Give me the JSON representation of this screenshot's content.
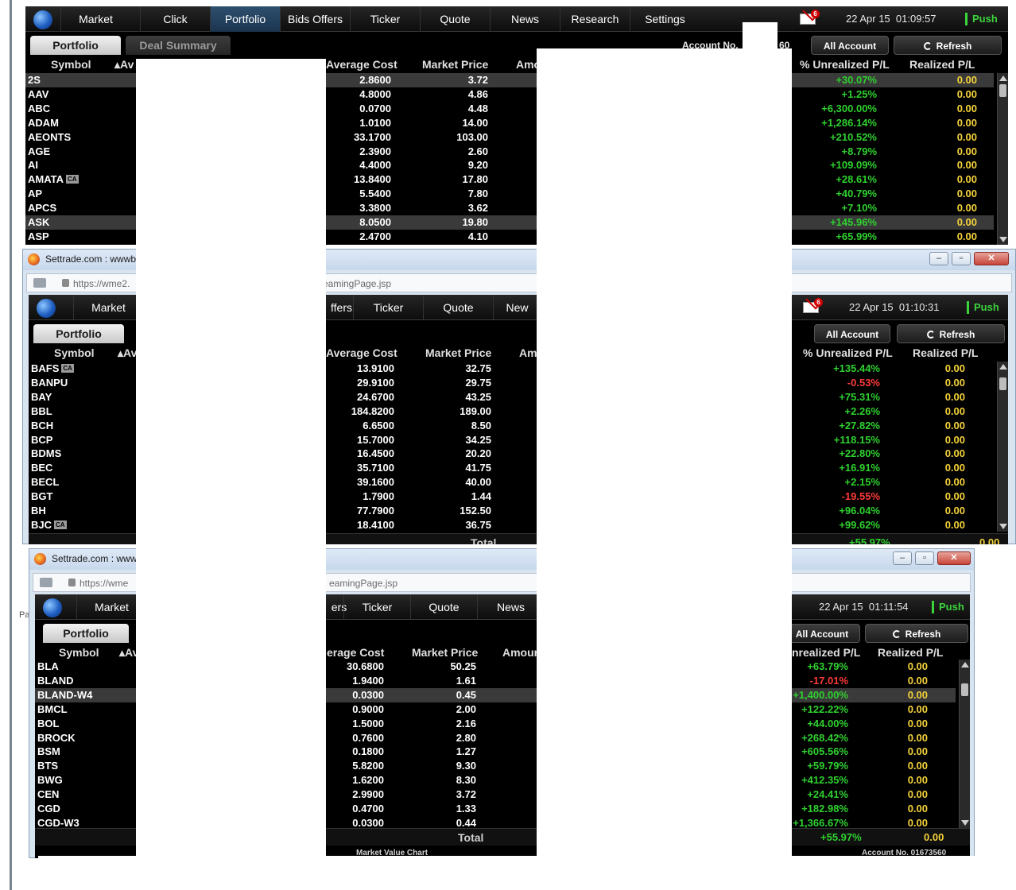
{
  "desktop": {
    "partial_label": "Pa"
  },
  "columns": {
    "symbol": "Symbol",
    "average_cost": "Average Cost",
    "market_price": "Market Price",
    "unrealized_pct": "% Unrealized P/L",
    "realized": "Realized P/L",
    "amount_partial": "Amo"
  },
  "panels": [
    {
      "title": "",
      "url": "",
      "nav": [
        "Market",
        "Click",
        "Portfolio",
        "Bids Offers",
        "Ticker",
        "Quote",
        "News",
        "Research",
        "Settings"
      ],
      "mail_count": "6",
      "date": "22 Apr 15",
      "time": "01:09:57",
      "push": "Push",
      "tabs": [
        "Portfolio",
        "Deal Summary"
      ],
      "account_label": "Account No.",
      "account_partial": "60",
      "all_account": "All Account",
      "refresh": "Refresh",
      "rows": [
        {
          "symbol": "2S",
          "avg": "2.8600",
          "price": "3.72",
          "pct": "+30.07%",
          "realized": "0.00",
          "sel": true
        },
        {
          "symbol": "AAV",
          "avg": "4.8000",
          "price": "4.86",
          "pct": "+1.25%",
          "realized": "0.00"
        },
        {
          "symbol": "ABC",
          "avg": "0.0700",
          "price": "4.48",
          "pct": "+6,300.00%",
          "realized": "0.00"
        },
        {
          "symbol": "ADAM",
          "avg": "1.0100",
          "price": "14.00",
          "pct": "+1,286.14%",
          "realized": "0.00"
        },
        {
          "symbol": "AEONTS",
          "avg": "33.1700",
          "price": "103.00",
          "pct": "+210.52%",
          "realized": "0.00"
        },
        {
          "symbol": "AGE",
          "avg": "2.3900",
          "price": "2.60",
          "pct": "+8.79%",
          "realized": "0.00"
        },
        {
          "symbol": "AI",
          "avg": "4.4000",
          "price": "9.20",
          "pct": "+109.09%",
          "realized": "0.00"
        },
        {
          "symbol": "AMATA",
          "ca": "CA",
          "avg": "13.8400",
          "price": "17.80",
          "pct": "+28.61%",
          "realized": "0.00"
        },
        {
          "symbol": "AP",
          "avg": "5.5400",
          "price": "7.80",
          "pct": "+40.79%",
          "realized": "0.00"
        },
        {
          "symbol": "APCS",
          "avg": "3.3800",
          "price": "3.62",
          "pct": "+7.10%",
          "realized": "0.00"
        },
        {
          "symbol": "ASK",
          "avg": "8.0500",
          "price": "19.80",
          "pct": "+145.96%",
          "realized": "0.00",
          "sel": true
        },
        {
          "symbol": "ASP",
          "avg": "2.4700",
          "price": "4.10",
          "pct": "+65.99%",
          "realized": "0.00"
        }
      ]
    },
    {
      "title": "Settrade.com : wwwb",
      "url": "https://wme2.",
      "url_tail": "eamingPage.jsp",
      "nav": [
        "Market",
        "ffers",
        "Ticker",
        "Quote",
        "New"
      ],
      "mail_count": "6",
      "date": "22 Apr 15",
      "time": "01:10:31",
      "push": "Push",
      "tabs": [
        "Portfolio"
      ],
      "all_account": "All Account",
      "refresh": "Refresh",
      "total_label": "Total",
      "total_pct": "+55.97%",
      "total_realized": "0.00",
      "rows": [
        {
          "symbol": "BAFS",
          "ca": "CA",
          "avg": "13.9100",
          "price": "32.75",
          "pct": "+135.44%",
          "realized": "0.00"
        },
        {
          "symbol": "BANPU",
          "avg": "29.9100",
          "price": "29.75",
          "pct": "-0.53%",
          "realized": "0.00"
        },
        {
          "symbol": "BAY",
          "avg": "24.6700",
          "price": "43.25",
          "pct": "+75.31%",
          "realized": "0.00"
        },
        {
          "symbol": "BBL",
          "avg": "184.8200",
          "price": "189.00",
          "pct": "+2.26%",
          "realized": "0.00"
        },
        {
          "symbol": "BCH",
          "avg": "6.6500",
          "price": "8.50",
          "pct": "+27.82%",
          "realized": "0.00"
        },
        {
          "symbol": "BCP",
          "avg": "15.7000",
          "price": "34.25",
          "pct": "+118.15%",
          "realized": "0.00"
        },
        {
          "symbol": "BDMS",
          "avg": "16.4500",
          "price": "20.20",
          "pct": "+22.80%",
          "realized": "0.00"
        },
        {
          "symbol": "BEC",
          "avg": "35.7100",
          "price": "41.75",
          "pct": "+16.91%",
          "realized": "0.00"
        },
        {
          "symbol": "BECL",
          "avg": "39.1600",
          "price": "40.00",
          "pct": "+2.15%",
          "realized": "0.00"
        },
        {
          "symbol": "BGT",
          "avg": "1.7900",
          "price": "1.44",
          "pct": "-19.55%",
          "realized": "0.00"
        },
        {
          "symbol": "BH",
          "avg": "77.7900",
          "price": "152.50",
          "pct": "+96.04%",
          "realized": "0.00"
        },
        {
          "symbol": "BJC",
          "ca": "CA",
          "avg": "18.4100",
          "price": "36.75",
          "pct": "+99.62%",
          "realized": "0.00"
        }
      ]
    },
    {
      "title": "Settrade.com : www",
      "url": "https://wme",
      "url_tail": "eamingPage.jsp",
      "nav": [
        "Market",
        "ers",
        "Ticker",
        "Quote",
        "News"
      ],
      "date": "22 Apr 15",
      "time": "01:11:54",
      "push": "Push",
      "tabs": [
        "Portfolio"
      ],
      "all_account": "All Account",
      "refresh": "Refresh",
      "amount_partial": "Amour",
      "unrealized_partial": "nrealized P/L",
      "avg_partial": "erage Cost",
      "total_label": "Total",
      "total_pct": "+55.97%",
      "total_realized": "0.00",
      "footer_chart": "Market Value Chart",
      "footer_account": "Account No. 01673560",
      "rows": [
        {
          "symbol": "BLA",
          "avg": "30.6800",
          "price": "50.25",
          "pct": "+63.79%",
          "realized": "0.00"
        },
        {
          "symbol": "BLAND",
          "avg": "1.9400",
          "price": "1.61",
          "pct": "-17.01%",
          "realized": "0.00"
        },
        {
          "symbol": "BLAND-W4",
          "avg": "0.0300",
          "price": "0.45",
          "pct": "+1,400.00%",
          "realized": "0.00",
          "sel": true
        },
        {
          "symbol": "BMCL",
          "avg": "0.9000",
          "price": "2.00",
          "pct": "+122.22%",
          "realized": "0.00"
        },
        {
          "symbol": "BOL",
          "avg": "1.5000",
          "price": "2.16",
          "pct": "+44.00%",
          "realized": "0.00"
        },
        {
          "symbol": "BROCK",
          "avg": "0.7600",
          "price": "2.80",
          "pct": "+268.42%",
          "realized": "0.00"
        },
        {
          "symbol": "BSM",
          "avg": "0.1800",
          "price": "1.27",
          "pct": "+605.56%",
          "realized": "0.00"
        },
        {
          "symbol": "BTS",
          "avg": "5.8200",
          "price": "9.30",
          "pct": "+59.79%",
          "realized": "0.00"
        },
        {
          "symbol": "BWG",
          "avg": "1.6200",
          "price": "8.30",
          "pct": "+412.35%",
          "realized": "0.00"
        },
        {
          "symbol": "CEN",
          "avg": "2.9900",
          "price": "3.72",
          "pct": "+24.41%",
          "realized": "0.00"
        },
        {
          "symbol": "CGD",
          "avg": "0.4700",
          "price": "1.33",
          "pct": "+182.98%",
          "realized": "0.00"
        },
        {
          "symbol": "CGD-W3",
          "avg": "0.0300",
          "price": "0.44",
          "pct": "+1,366.67%",
          "realized": "0.00"
        }
      ]
    }
  ],
  "colors": {
    "positive": "#2fd12f",
    "negative": "#ff3a3a",
    "realized": "#f4d23a",
    "accent": "#2e4f6e"
  }
}
